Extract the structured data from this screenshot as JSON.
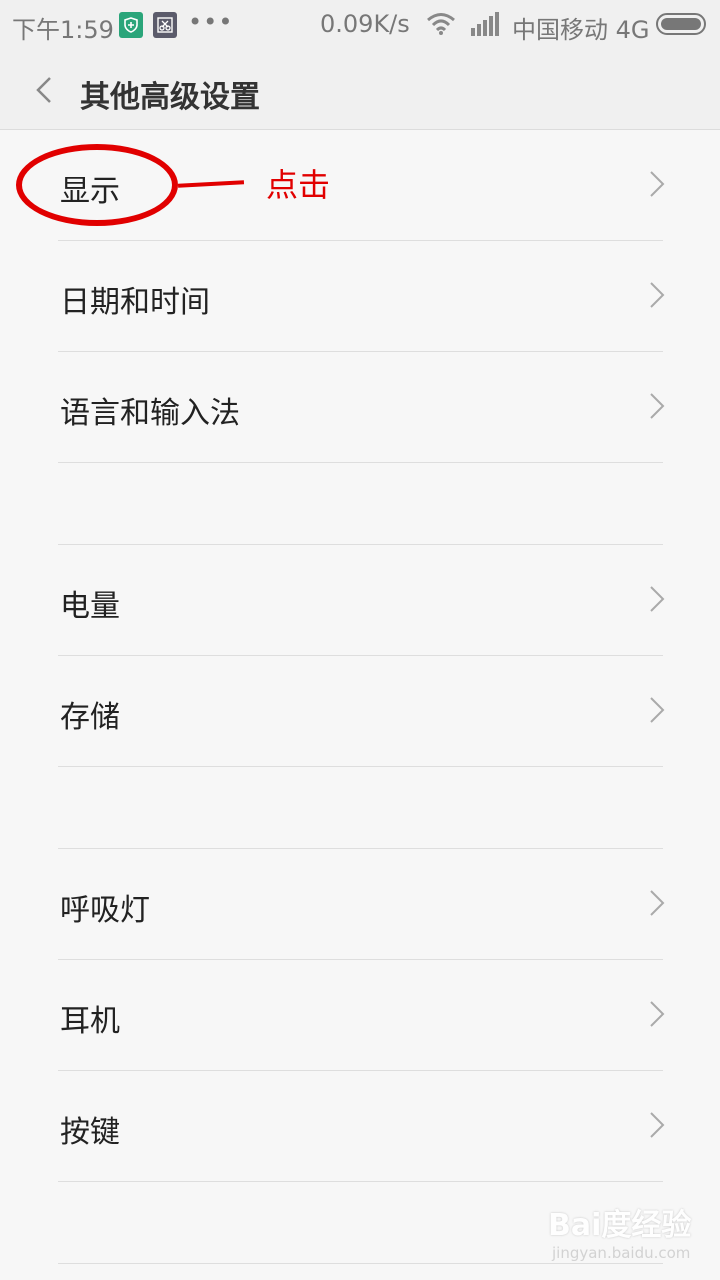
{
  "status_bar": {
    "time": "下午1:59",
    "dots": "•••",
    "speed": "0.09K/s",
    "carrier": "中国移动 4G",
    "icons": [
      "shield-icon",
      "scissors-icon",
      "wifi-icon",
      "signal-icon",
      "battery-icon"
    ]
  },
  "header": {
    "title": "其他高级设置",
    "back_icon": "chevron-left-icon"
  },
  "menu": [
    {
      "label": "显示"
    },
    {
      "label": "日期和时间"
    },
    {
      "label": "语言和输入法"
    },
    {
      "label": "电量"
    },
    {
      "label": "存储"
    },
    {
      "label": "呼吸灯"
    },
    {
      "label": "耳机"
    },
    {
      "label": "按键"
    }
  ],
  "annotation": {
    "text": "点击",
    "color": "#e10000"
  },
  "watermark": {
    "main": "Bai度经验",
    "sub": "jingyan.baidu.com"
  },
  "colors": {
    "background": "#f7f7f7",
    "accent_annotation": "#e10000"
  }
}
